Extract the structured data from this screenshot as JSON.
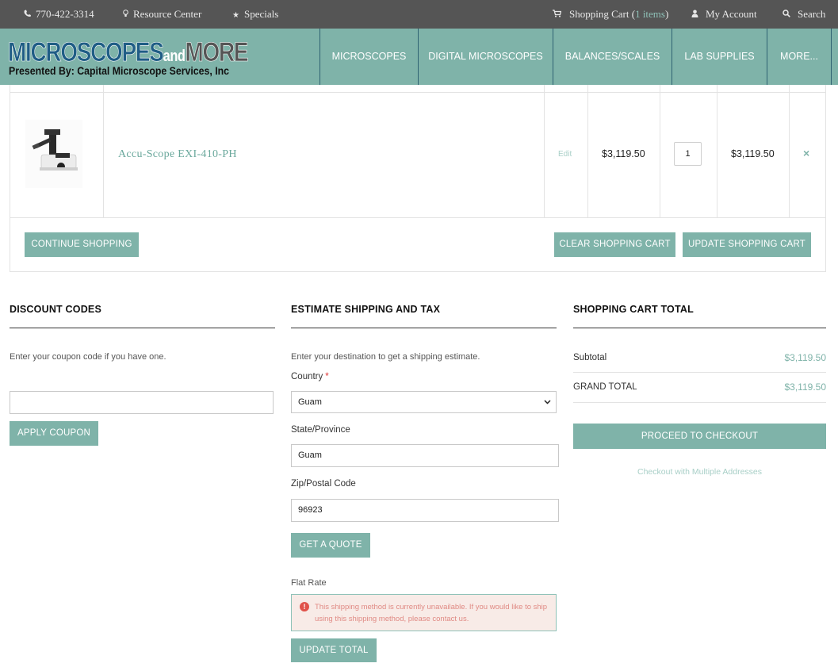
{
  "topbar": {
    "phone": "770-422-3314",
    "resource": "Resource Center",
    "specials": "Specials",
    "cart_label": "Shopping Cart (",
    "cart_count": "1 items",
    "cart_close": ")",
    "account": "My Account",
    "search": "Search"
  },
  "logo": {
    "main_a": "MICROSCOPES",
    "main_and": "and",
    "main_b": "MORE",
    "sub": "Presented By: Capital Microscope Services, Inc"
  },
  "nav": {
    "items": [
      "MICROSCOPES",
      "DIGITAL MICROSCOPES",
      "BALANCES/SCALES",
      "LAB SUPPLIES",
      "MORE..."
    ]
  },
  "cart": {
    "product_name": "Accu-Scope EXI-410-PH",
    "edit_label": "Edit",
    "unit_price": "$3,119.50",
    "qty": "1",
    "row_total": "$3,119.50",
    "remove_icon": "×"
  },
  "buttons": {
    "continue": "CONTINUE SHOPPING",
    "clear": "CLEAR SHOPPING CART",
    "update": "UPDATE SHOPPING CART",
    "apply": "APPLY COUPON",
    "quote": "GET A QUOTE",
    "update_total": "UPDATE TOTAL",
    "checkout": "PROCEED TO CHECKOUT"
  },
  "discount": {
    "title": "DISCOUNT CODES",
    "hint": "Enter your coupon code if you have one.",
    "value": ""
  },
  "shipping": {
    "title": "ESTIMATE SHIPPING AND TAX",
    "hint": "Enter your destination to get a shipping estimate.",
    "country_label": "Country",
    "required_mark": "*",
    "country_value": "Guam",
    "state_label": "State/Province",
    "state_value": "Guam",
    "zip_label": "Zip/Postal Code",
    "zip_value": "96923",
    "method_label": "Flat Rate",
    "error_icon": "!",
    "error_text": "This shipping method is currently unavailable. If you would like to ship using this shipping method, please contact us."
  },
  "totals": {
    "title": "SHOPPING CART TOTAL",
    "subtotal_label": "Subtotal",
    "subtotal_value": "$3,119.50",
    "grand_label": "GRAND TOTAL",
    "grand_value": "$3,119.50",
    "multi_link": "Checkout with Multiple Addresses"
  },
  "icons": {
    "phone": "phone-icon",
    "resource": "lightbulb-icon",
    "specials": "star-icon",
    "cart": "cart-icon",
    "account": "user-icon",
    "search": "search-icon"
  },
  "colors": {
    "accent": "#7fb3a9",
    "topbar": "#555555",
    "logo_blue": "#1f5d85"
  }
}
